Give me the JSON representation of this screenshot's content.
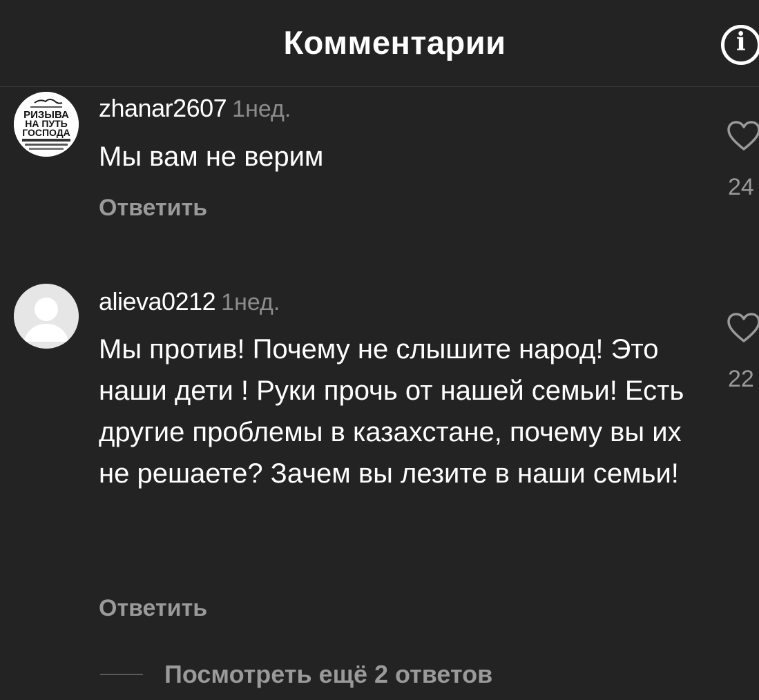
{
  "header": {
    "title": "Комментарии",
    "info_icon": "info-icon"
  },
  "comments": [
    {
      "avatar": {
        "type": "logo",
        "lines": [
          "РИЗЫВА",
          "НА ПУТЬ",
          "ГОСПОДА"
        ]
      },
      "username": "zhanar2607",
      "time": "1нед.",
      "text": "Мы вам не верим",
      "reply_label": "Ответить",
      "like_icon": "heart-outline-icon",
      "like_count": "24"
    },
    {
      "avatar": {
        "type": "default-person"
      },
      "username": "alieva0212",
      "time": "1нед.",
      "text": "Мы против! Почему не слышите народ! Это наши дети ! Руки прочь от нашей семьи! Есть другие проблемы в казахстане, почему вы их не решаете? Зачем вы лезите в наши семьи!",
      "reply_label": "Ответить",
      "like_icon": "heart-outline-icon",
      "like_count": "22",
      "view_more_label": "Посмотреть ещё 2 ответов"
    }
  ],
  "colors": {
    "background": "#232323",
    "primary_text": "#ffffff",
    "secondary_text": "#9a9a9a",
    "timestamp": "#8c8c8c",
    "avatar_default": "#e6e6e6"
  }
}
